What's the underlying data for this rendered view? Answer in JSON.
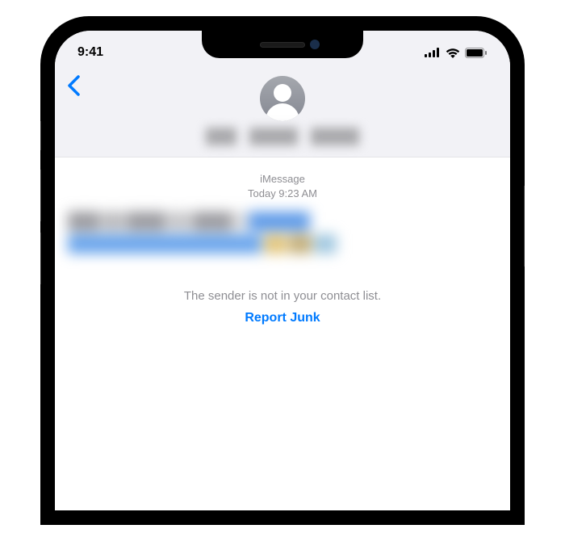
{
  "statusBar": {
    "time": "9:41"
  },
  "conversation": {
    "service": "iMessage",
    "timestamp": "Today 9:23 AM",
    "senderNotice": "The sender is not in your contact list.",
    "reportLabel": "Report Junk"
  },
  "colors": {
    "iosBlue": "#007aff",
    "secondaryText": "#8e8e93",
    "headerBg": "#f2f2f6"
  }
}
